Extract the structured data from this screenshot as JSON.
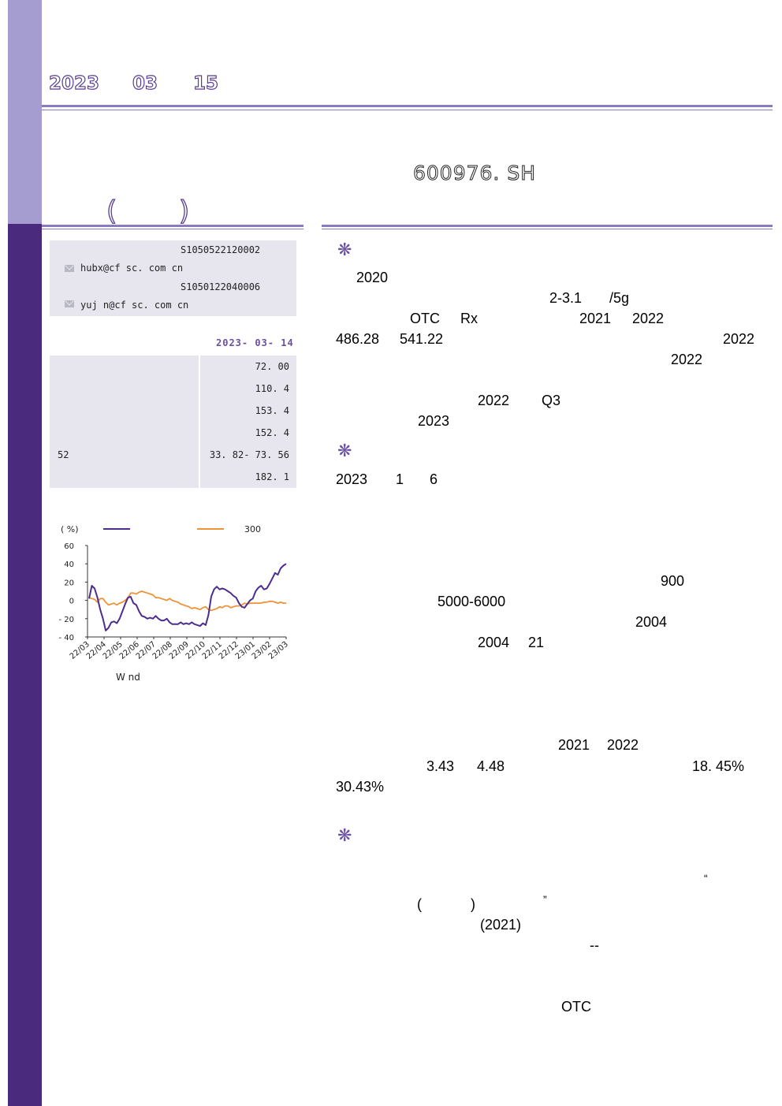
{
  "header": {
    "date_year": "2023",
    "date_month": "03",
    "date_day": "15",
    "ticker": "600976. SH",
    "paren_open": "(",
    "paren_close": ")"
  },
  "analysts": [
    {
      "cert": "S1050522120002",
      "email": "hubx@cf sc. com cn"
    },
    {
      "cert": "S1050122040006",
      "email": "yuj n@cf sc. com cn"
    }
  ],
  "data_date": "2023- 03- 14",
  "stock_table": [
    {
      "label": "",
      "value": "72. 00"
    },
    {
      "label": "",
      "value": "110. 4"
    },
    {
      "label": "",
      "value": "153. 4"
    },
    {
      "label": "",
      "value": "152. 4"
    },
    {
      "label": "52",
      "value": "33. 82- 73. 56"
    },
    {
      "label": "",
      "value": "182. 1"
    }
  ],
  "chart_data": {
    "type": "line",
    "ylabel": "( %)",
    "ylim": [
      -40,
      60
    ],
    "yticks": [
      "60",
      "40",
      "20",
      "0",
      "- 20",
      "- 40"
    ],
    "x_labels": [
      "22/03",
      "22/04",
      "22/05",
      "22/06",
      "22/07",
      "22/08",
      "22/09",
      "22/10",
      "22/11",
      "22/12",
      "23/01",
      "23/02",
      "23/03"
    ],
    "source": "W nd",
    "colors": {
      "stock": "#4b2d8f",
      "index": "#f0923a"
    },
    "series": [
      {
        "name": "",
        "legend_color": "#4b2d8f",
        "values": [
          2,
          16,
          13,
          3,
          -10,
          -20,
          -33,
          -30,
          -24,
          -23,
          -25,
          -20,
          -12,
          -4,
          3,
          4,
          -3,
          -5,
          -12,
          -17,
          -18,
          -20,
          -19,
          -20,
          -17,
          -20,
          -22,
          -22,
          -20,
          -24,
          -26,
          -26,
          -26,
          -24,
          -26,
          -25,
          -26,
          -24,
          -26,
          -27,
          -28,
          -25,
          -27,
          -16,
          4,
          12,
          15,
          12,
          13,
          12,
          10,
          8,
          5,
          3,
          -3,
          -7,
          -8,
          -4,
          0,
          2,
          10,
          14,
          16,
          12,
          13,
          18,
          24,
          30,
          28,
          35,
          38,
          40
        ]
      },
      {
        "name": "300",
        "legend_color": "#f0923a",
        "values": [
          3,
          2,
          1,
          -2,
          2,
          2,
          -2,
          -5,
          -4,
          -3,
          -5,
          -3,
          -2,
          0,
          3,
          8,
          8,
          7,
          9,
          10,
          9,
          8,
          7,
          6,
          3,
          3,
          2,
          1,
          0,
          2,
          0,
          -1,
          -2,
          -4,
          -5,
          -6,
          -7,
          -9,
          -8,
          -9,
          -10,
          -8,
          -7,
          -10,
          -11,
          -10,
          -9,
          -7,
          -8,
          -6,
          -6,
          -8,
          -7,
          -6,
          -6,
          -5,
          -3,
          -4,
          -3,
          -3,
          -3,
          -3,
          -3,
          -2,
          -2,
          -1,
          -1,
          -2,
          -3,
          -2,
          -3,
          -3
        ]
      }
    ]
  },
  "body": {
    "s1_l1": "2020",
    "s1_l2a": "2-3.1",
    "s1_l2b": "/5g",
    "s1_l3a": "OTC",
    "s1_l3b": "Rx",
    "s1_l3c": "2021",
    "s1_l3d": "2022",
    "s1_l4a": "486.28",
    "s1_l4b": "541.22",
    "s1_l4c": "2022",
    "s1_l5": "2022",
    "s1_l6a": "2022",
    "s1_l6b": "Q3",
    "s1_l7": "2023",
    "s2_l1a": "2023",
    "s2_l1b": "1",
    "s2_l1c": "6",
    "s3_l1": "900",
    "s3_l2": "5000-6000",
    "s3_l3": "2004",
    "s3_l4a": "2004",
    "s3_l4b": "21",
    "s4_l1a": "2021",
    "s4_l1b": "2022",
    "s4_l2a": "3.43",
    "s4_l2b": "4.48",
    "s4_l2c": "18. 45%",
    "s4_l3": "30.43%",
    "s5_q1": "“",
    "s5_p1": "(",
    "s5_p2": ")",
    "s5_q2": "”",
    "s5_l3": "(2021)",
    "s5_l4": "--",
    "s5_l5": "OTC"
  },
  "star_glyph": "❋"
}
